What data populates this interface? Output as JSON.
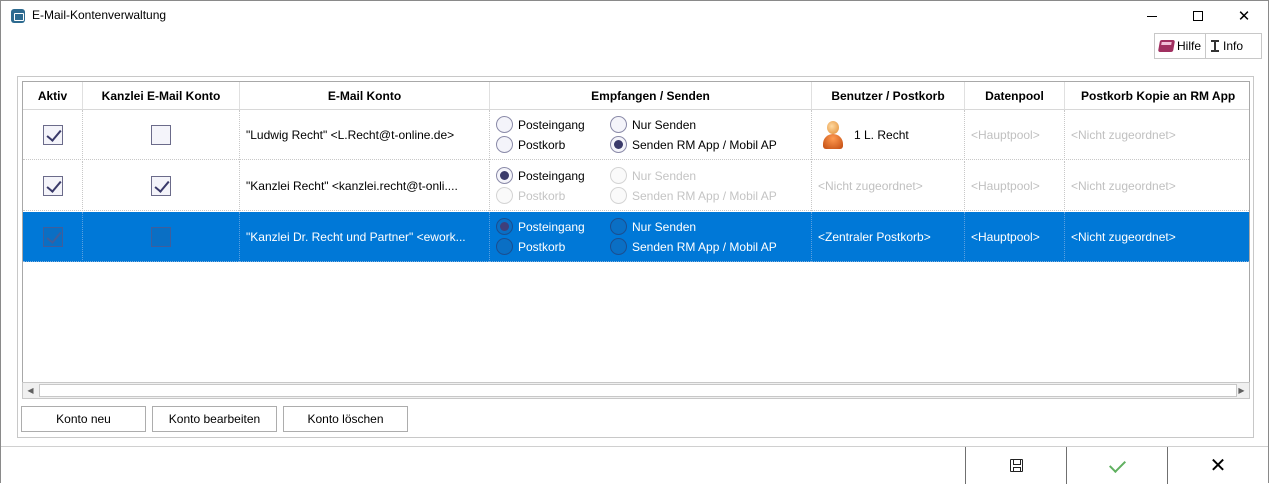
{
  "window": {
    "title": "E-Mail-Kontenverwaltung",
    "controls": {
      "minimize": "minimize",
      "maximize": "maximize",
      "close": "✕"
    }
  },
  "help": {
    "hilfe_label": "Hilfe",
    "info_label": "Info"
  },
  "table": {
    "columns": [
      "Aktiv",
      "Kanzlei E-Mail Konto",
      "E-Mail Konto",
      "Empfangen / Senden",
      "Benutzer / Postkorb",
      "Datenpool",
      "Postkorb Kopie an RM App"
    ],
    "rows": [
      {
        "aktiv": true,
        "kanzlei": false,
        "email": "\"Ludwig Recht\" <L.Recht@t-online.de>",
        "radio_posteingang": "Posteingang",
        "radio_postkorb": "Postkorb",
        "radio_nur_senden": "Nur Senden",
        "radio_senden_rm": "Senden RM App / Mobil AP",
        "benutzer": "1 L. Recht",
        "datenpool": "<Hauptpool>",
        "kopie": "<Nicht zugeordnet>",
        "selected": false
      },
      {
        "aktiv": true,
        "kanzlei": true,
        "email": "\"Kanzlei Recht\" <kanzlei.recht@t-onli....",
        "radio_posteingang": "Posteingang",
        "radio_postkorb": "Postkorb",
        "radio_nur_senden": "Nur Senden",
        "radio_senden_rm": "Senden RM App / Mobil AP",
        "benutzer": "<Nicht zugeordnet>",
        "datenpool": "<Hauptpool>",
        "kopie": "<Nicht zugeordnet>",
        "selected": false
      },
      {
        "aktiv": true,
        "kanzlei": false,
        "email": "\"Kanzlei Dr. Recht und Partner\" <ework...",
        "radio_posteingang": "Posteingang",
        "radio_postkorb": "Postkorb",
        "radio_nur_senden": "Nur Senden",
        "radio_senden_rm": "Senden RM App / Mobil AP",
        "benutzer": "<Zentraler Postkorb>",
        "datenpool": "<Hauptpool>",
        "kopie": "<Nicht zugeordnet>",
        "selected": true
      }
    ]
  },
  "actions": {
    "konto_neu": "Konto neu",
    "konto_bearbeiten": "Konto bearbeiten",
    "konto_loeschen": "Konto löschen"
  },
  "footer": {
    "close_glyph": "✕"
  },
  "icons": {
    "app": "mail-account-icon",
    "help": "book-icon",
    "info": "info-icon",
    "user": "person-icon",
    "save": "save-icon",
    "ok": "check-icon",
    "cancel": "close-icon"
  },
  "colors": {
    "selection": "#0078d7",
    "check_ok": "#60b060"
  }
}
